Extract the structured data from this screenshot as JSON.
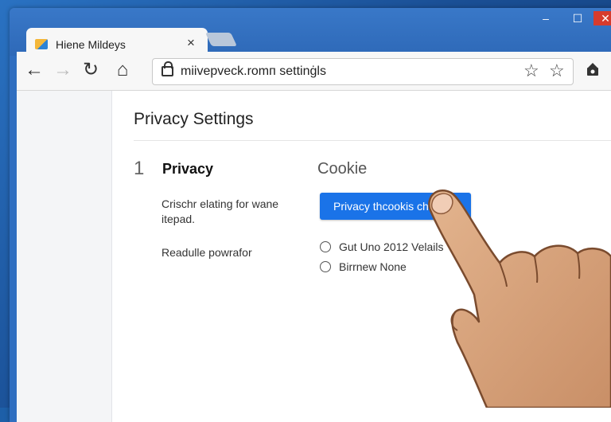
{
  "browser": {
    "tab_title": "Hiene Mildeys",
    "tab_close": "×",
    "url": "miivepvеck.romп settinġls",
    "window_controls": {
      "minimize": "–",
      "maximize": "☐",
      "close": "✕"
    },
    "nav": {
      "back": "←",
      "forward": "→",
      "reload": "↻",
      "home": "⌂"
    },
    "icons": [
      "favicon",
      "lock-icon",
      "star-outline-icon",
      "star-outline-icon",
      "extension-icon"
    ]
  },
  "page": {
    "title": "Privacy Settings",
    "section_number": "1",
    "section_title": "Privacy",
    "description": "Crischr elating for wane itepad.",
    "secondary_label": "Readulle powrafor",
    "cookie_heading": "Cookie",
    "primary_button_label": "Privacy thcookis ch",
    "options": [
      {
        "label": "Gut Uno 2012 Velails",
        "selected": false
      },
      {
        "label": "Birrnew None",
        "selected": false
      }
    ]
  },
  "colors": {
    "accent": "#1a73e8",
    "window_frame": "#2f6ec0",
    "close_button": "#d63b2d",
    "sidebar": "#f4f5f7"
  }
}
